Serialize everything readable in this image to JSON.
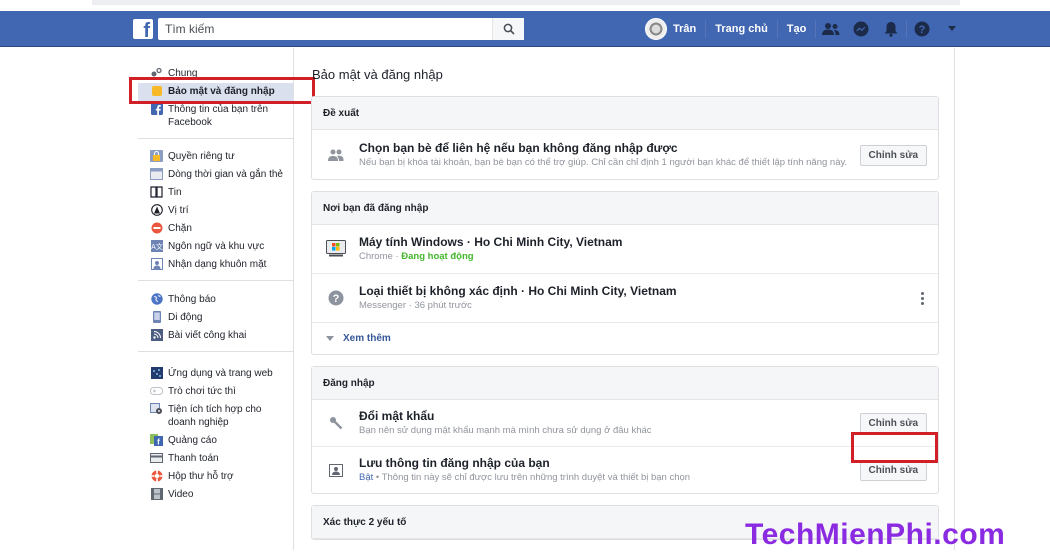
{
  "header": {
    "logo": "f",
    "search_placeholder": "Tìm kiếm",
    "user_name": "Trân",
    "home": "Trang chủ",
    "create": "Tạo",
    "icons": [
      "friends-icon",
      "messenger-icon",
      "notifications-icon",
      "help-icon",
      "dropdown-icon"
    ]
  },
  "sidebar": {
    "groups": [
      [
        {
          "label": "Chung",
          "icon": "gears-icon"
        },
        {
          "label": "Bảo mật và đăng nhập",
          "icon": "security-icon",
          "active": true
        },
        {
          "label": "Thông tin của bạn trên Facebook",
          "icon": "facebook-icon"
        }
      ],
      [
        {
          "label": "Quyền riêng tư",
          "icon": "privacy-lock-icon"
        },
        {
          "label": "Dòng thời gian và gắn thẻ",
          "icon": "timeline-icon"
        },
        {
          "label": "Tin",
          "icon": "book-icon"
        },
        {
          "label": "Vị trí",
          "icon": "location-icon"
        },
        {
          "label": "Chặn",
          "icon": "block-icon"
        },
        {
          "label": "Ngôn ngữ và khu vực",
          "icon": "language-icon"
        },
        {
          "label": "Nhận dạng khuôn mặt",
          "icon": "face-recognition-icon"
        }
      ],
      [
        {
          "label": "Thông báo",
          "icon": "globe-icon"
        },
        {
          "label": "Di động",
          "icon": "mobile-icon"
        },
        {
          "label": "Bài viết công khai",
          "icon": "rss-icon"
        }
      ],
      [
        {
          "label": "Ứng dụng và trang web",
          "icon": "apps-icon"
        },
        {
          "label": "Trò chơi tức thì",
          "icon": "gamepad-icon"
        },
        {
          "label": "Tiện ích tích hợp cho doanh nghiệp",
          "icon": "business-integrations-icon"
        },
        {
          "label": "Quảng cáo",
          "icon": "ads-icon"
        },
        {
          "label": "Thanh toán",
          "icon": "payment-card-icon"
        },
        {
          "label": "Hộp thư hỗ trợ",
          "icon": "lifebuoy-icon"
        },
        {
          "label": "Video",
          "icon": "film-icon"
        }
      ]
    ]
  },
  "main": {
    "title": "Bảo mật và đăng nhập",
    "sections": {
      "recommended": {
        "header": "Đề xuất",
        "rows": [
          {
            "title": "Chọn bạn bè để liên hệ nếu bạn không đăng nhập được",
            "subtitle": "Nếu bạn bị khóa tài khoản, bạn bè bạn có thể trợ giúp. Chỉ cần chỉ định 1 người bạn khác để thiết lập tính năng này.",
            "button": "Chỉnh sửa"
          }
        ]
      },
      "where_logged_in": {
        "header": "Nơi bạn đã đăng nhập",
        "rows": [
          {
            "title": "Máy tính Windows · Ho Chi Minh City, Vietnam",
            "app": "Chrome",
            "status": "Đang hoạt động"
          },
          {
            "title": "Loại thiết bị không xác định · Ho Chi Minh City, Vietnam",
            "app": "Messenger",
            "time": "36 phút trước"
          }
        ],
        "see_more": "Xem thêm"
      },
      "login": {
        "header": "Đăng nhập",
        "rows": [
          {
            "title": "Đổi mật khẩu",
            "subtitle": "Bạn nên sử dụng mật khẩu mạnh mà mình chưa sử dụng ở đâu khác",
            "button": "Chỉnh sửa"
          },
          {
            "title": "Lưu thông tin đăng nhập của bạn",
            "state": "Bật",
            "subtitle": "Thông tin này sẽ chỉ được lưu trên những trình duyệt và thiết bị bạn chọn",
            "button": "Chỉnh sửa"
          }
        ]
      },
      "two_factor": {
        "header": "Xác thực 2 yếu tố"
      }
    }
  },
  "watermark": "TechMienPhi.com",
  "colors": {
    "brand_blue": "#4267b2",
    "highlight_red": "#d01f27",
    "active_green": "#42b72a",
    "watermark_purple": "#8a2be2"
  }
}
